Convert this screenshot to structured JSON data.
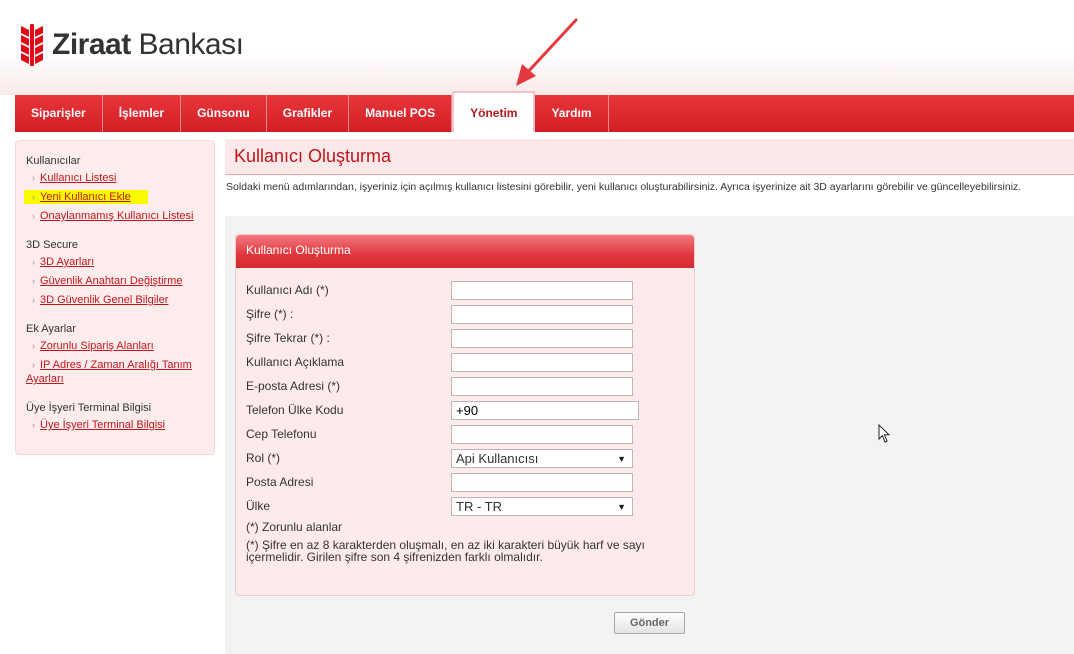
{
  "brand": {
    "name_bold": "Ziraat",
    "name_rest": " Bankası",
    "color": "#e30a17"
  },
  "nav": {
    "items": [
      {
        "label": "Siparişler",
        "active": false
      },
      {
        "label": "İşlemler",
        "active": false
      },
      {
        "label": "Günsonu",
        "active": false
      },
      {
        "label": "Grafikler",
        "active": false
      },
      {
        "label": "Manuel POS",
        "active": false
      },
      {
        "label": "Yönetim",
        "active": true
      },
      {
        "label": "Yardım",
        "active": false
      }
    ]
  },
  "sidebar": {
    "sections": [
      {
        "title": "Kullanıcılar",
        "links": [
          "Kullanıcı Listesi",
          "Yeni Kullanıcı Ekle",
          "Onaylanmamış Kullanıcı Listesi"
        ]
      },
      {
        "title": "3D Secure",
        "links": [
          "3D Ayarları",
          "Güvenlik Anahtarı Değiştirme",
          "3D Güvenlik Genel Bilgiler"
        ]
      },
      {
        "title": "Ek Ayarlar",
        "links": [
          "Zorunlu Sipariş Alanları",
          "IP Adres / Zaman Aralığı Tanım",
          "Ayarları"
        ]
      },
      {
        "title": "Üye İşyeri Terminal Bilgisi",
        "links": [
          "Üye İşyeri Terminal Bilgisi"
        ]
      }
    ],
    "highlighted": "Yeni Kullanıcı Ekle"
  },
  "page": {
    "title": "Kullanıcı Oluşturma",
    "description": "Soldaki menü adımlarından, işyeriniz için açılmış kullanıcı listesini görebilir, yeni kullanıcı oluşturabilirsiniz. Ayrıca işyerinize ait 3D ayarlarını görebilir ve güncelleyebilirsiniz."
  },
  "form": {
    "panel_title": "Kullanıcı Oluşturma",
    "fields": {
      "username": {
        "label": "Kullanıcı Adı (*)",
        "value": ""
      },
      "password": {
        "label": "Şifre (*) :",
        "value": ""
      },
      "password_repeat": {
        "label": "Şifre Tekrar (*) :",
        "value": ""
      },
      "description": {
        "label": "Kullanıcı Açıklama",
        "value": ""
      },
      "email": {
        "label": "E-posta Adresi (*)",
        "value": ""
      },
      "country_code": {
        "label": "Telefon Ülke Kodu",
        "value": "+90"
      },
      "mobile": {
        "label": "Cep Telefonu",
        "value": ""
      },
      "role": {
        "label": "Rol (*)",
        "value": "Api Kullanıcısı"
      },
      "postal_address": {
        "label": "Posta Adresi",
        "value": ""
      },
      "country": {
        "label": "Ülke",
        "value": "TR - TR"
      }
    },
    "required_note": "(*) Zorunlu alanlar",
    "password_note_line1": "(*) Şifre en az 8 karakterden oluşmalı, en az iki karakteri büyük harf ve sayı",
    "password_note_line2": "içermelidir. Girilen şifre son 4 şifrenizden farklı olmalıdır.",
    "submit_label": "Gönder"
  }
}
